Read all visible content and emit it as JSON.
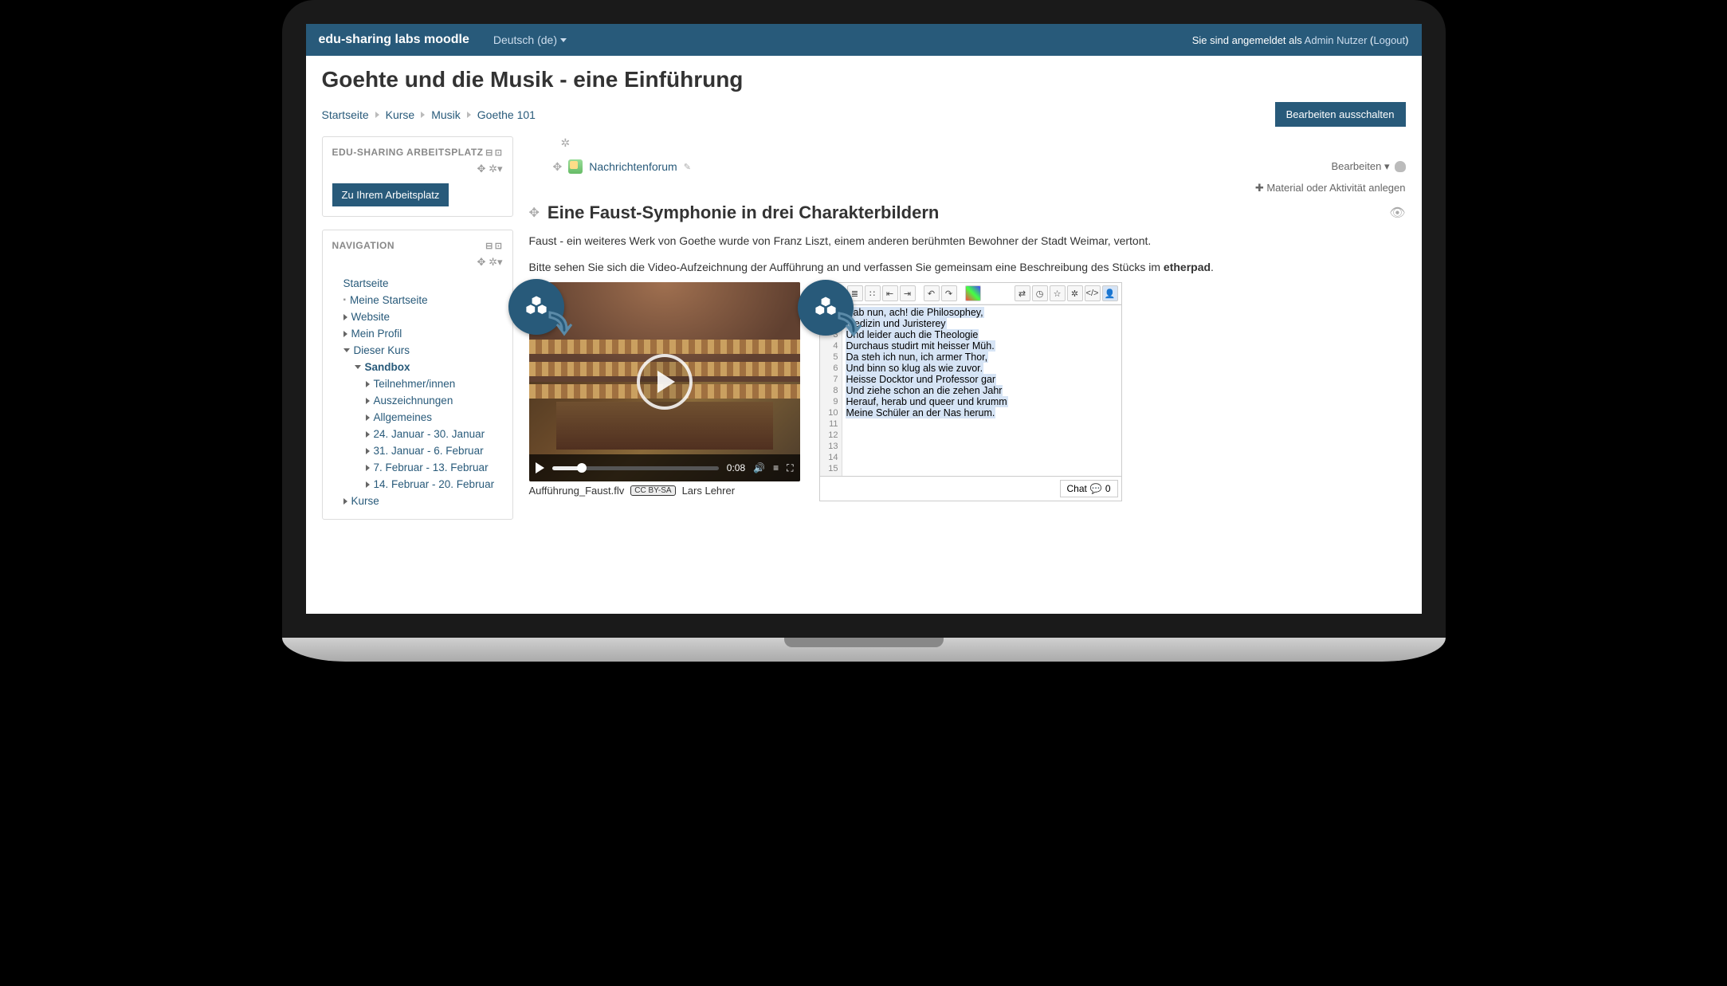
{
  "topbar": {
    "brand": "edu-sharing labs moodle",
    "language": "Deutsch (de)",
    "login_prefix": "Sie sind angemeldet als ",
    "user": "Admin Nutzer",
    "logout": "Logout"
  },
  "page": {
    "title": "Goehte und die Musik - eine Einführung",
    "edit_button": "Bearbeiten ausschalten"
  },
  "breadcrumb": [
    "Startseite",
    "Kurse",
    "Musik",
    "Goethe 101"
  ],
  "blocks": {
    "workspace": {
      "title": "EDU-SHARING ARBEITSPLATZ",
      "button": "Zu Ihrem Arbeitsplatz"
    },
    "navigation": {
      "title": "NAVIGATION",
      "root": "Startseite",
      "items": {
        "meine_startseite": "Meine Startseite",
        "website": "Website",
        "mein_profil": "Mein Profil",
        "dieser_kurs": "Dieser Kurs",
        "sandbox": "Sandbox",
        "teilnehmer": "Teilnehmer/innen",
        "auszeichnungen": "Auszeichnungen",
        "allgemeines": "Allgemeines",
        "w1": "24. Januar - 30. Januar",
        "w2": "31. Januar - 6. Februar",
        "w3": "7. Februar - 13. Februar",
        "w4": "14. Februar - 20. Februar",
        "kurse": "Kurse"
      }
    }
  },
  "activity": {
    "forum": "Nachrichtenforum",
    "bearbeiten": "Bearbeiten",
    "add": "Material oder Aktivität anlegen"
  },
  "section": {
    "title": "Eine Faust-Symphonie in drei Charakterbildern",
    "desc1": "Faust - ein weiteres Werk von Goethe wurde von Franz Liszt, einem anderen berühmten Bewohner der Stadt Weimar, vertont.",
    "desc2a": "Bitte sehen Sie sich die Video-Aufzeichnung der Aufführung an und verfassen Sie gemeinsam eine Beschreibung des Stücks im ",
    "desc2b": "etherpad",
    "desc2c": "."
  },
  "video": {
    "time": "0:08",
    "filename": "Aufführung_Faust.flv",
    "license": "CC BY-SA",
    "author": "Lars Lehrer"
  },
  "editor": {
    "lines": [
      "Hab nun, ach! die Philosophey,",
      "Medizin und Juristerey",
      "Und leider auch die Theologie",
      "Durchaus studirt mit heisser Müh.",
      "Da steh ich nun, ich armer Thor,",
      "Und binn so klug als wie zuvor.",
      "Heisse Docktor und Professor gar",
      "Und ziehe schon an die zehen Jahr",
      "Herauf, herab und queer und krumm",
      "Meine Schüler an der Nas herum."
    ],
    "chat": "Chat",
    "chat_count": "0"
  }
}
